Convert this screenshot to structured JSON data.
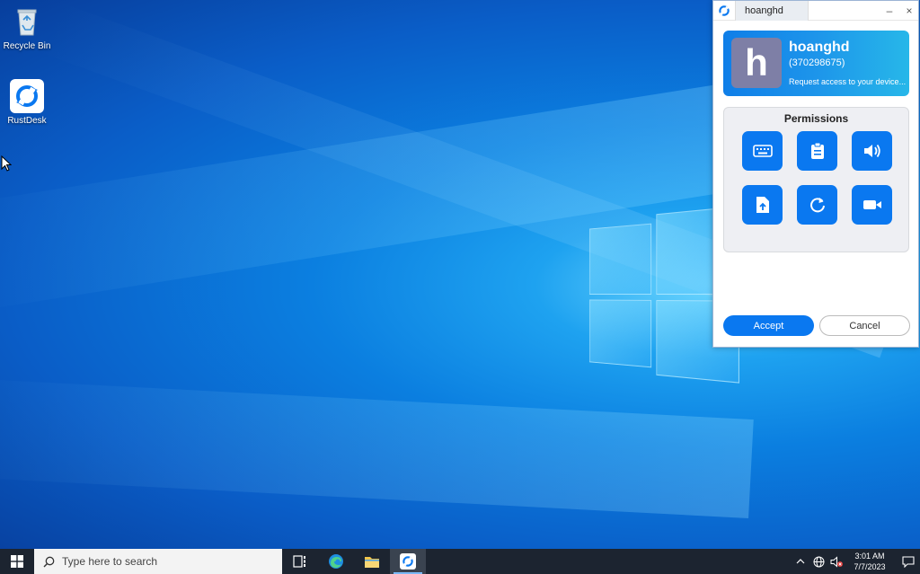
{
  "desktop": {
    "icons": [
      {
        "label": "Recycle Bin"
      },
      {
        "label": "RustDesk"
      }
    ]
  },
  "rustdesk_window": {
    "tab_title": "hoanghd",
    "controls": {
      "minimize": "–",
      "close": "×"
    },
    "peer": {
      "avatar_letter": "h",
      "name": "hoanghd",
      "id": "(370298675)",
      "request_text": "Request access to your device..."
    },
    "permissions": {
      "title": "Permissions",
      "items": [
        "keyboard-icon",
        "clipboard-icon",
        "audio-icon",
        "file-transfer-icon",
        "restart-icon",
        "recording-icon"
      ]
    },
    "accept_label": "Accept",
    "cancel_label": "Cancel"
  },
  "taskbar": {
    "search_placeholder": "Type here to search",
    "apps": [
      "task-view-icon",
      "edge-icon",
      "file-explorer-icon",
      "rustdesk-icon"
    ],
    "clock": {
      "time": "3:01 AM",
      "date": "7/7/2023"
    }
  }
}
